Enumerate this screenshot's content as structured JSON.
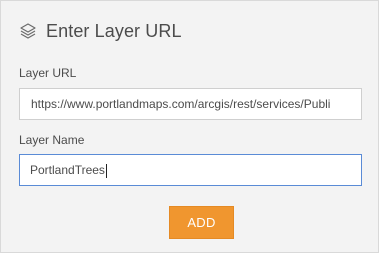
{
  "dialog": {
    "title": "Enter Layer URL",
    "icon": "layers-icon"
  },
  "fields": {
    "url": {
      "label": "Layer URL",
      "value": "https://www.portlandmaps.com/arcgis/rest/services/Publi"
    },
    "name": {
      "label": "Layer Name",
      "value": "PortlandTrees"
    }
  },
  "actions": {
    "add_label": "ADD"
  },
  "colors": {
    "panel_bg": "#f3f3f3",
    "add_button": "#f0962f",
    "focus_border": "#5a8bd6"
  }
}
